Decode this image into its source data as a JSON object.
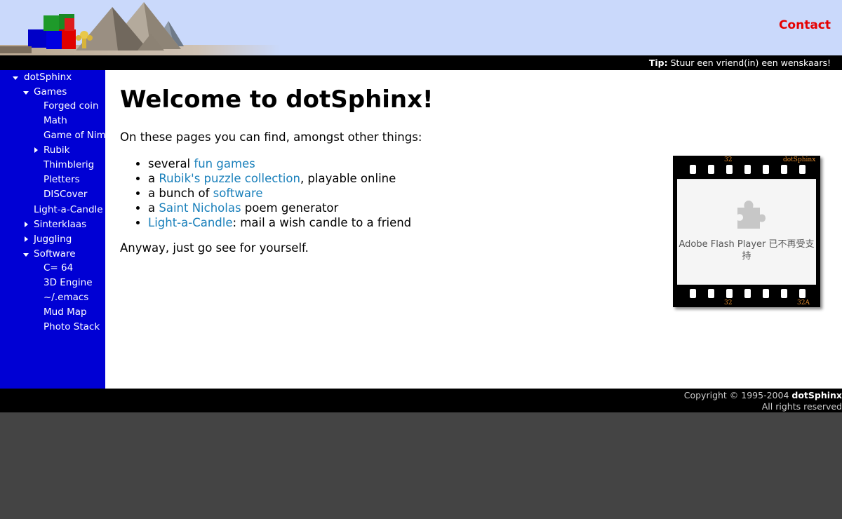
{
  "header": {
    "contact_label": "Contact",
    "tip_label": "Tip:",
    "tip_text": "Stuur een vriend(in) een wenskaars!"
  },
  "sidebar": {
    "items": [
      {
        "label": "dotSphinx",
        "arrow": "down"
      },
      {
        "label": "Games",
        "arrow": "down"
      },
      {
        "label": "Forged coin",
        "arrow": ""
      },
      {
        "label": "Math",
        "arrow": ""
      },
      {
        "label": "Game of Nim",
        "arrow": ""
      },
      {
        "label": "Rubik",
        "arrow": "right"
      },
      {
        "label": "Thimblerig",
        "arrow": ""
      },
      {
        "label": "Pletters",
        "arrow": ""
      },
      {
        "label": "DISCover",
        "arrow": ""
      },
      {
        "label": "Light-a-Candle",
        "arrow": ""
      },
      {
        "label": "Sinterklaas",
        "arrow": "right"
      },
      {
        "label": "Juggling",
        "arrow": "right"
      },
      {
        "label": "Software",
        "arrow": "down"
      },
      {
        "label": "C= 64",
        "arrow": ""
      },
      {
        "label": "3D Engine",
        "arrow": ""
      },
      {
        "label": "~/.emacs",
        "arrow": ""
      },
      {
        "label": "Mud Map",
        "arrow": ""
      },
      {
        "label": "Photo Stack",
        "arrow": ""
      }
    ]
  },
  "main": {
    "title": "Welcome to dotSphinx!",
    "intro": "On these pages you can find, amongst other things:",
    "bullets": [
      {
        "pre": "several ",
        "link": "fun games",
        "post": ""
      },
      {
        "pre": "a ",
        "link": "Rubik's puzzle collection",
        "post": ", playable online"
      },
      {
        "pre": "a bunch of ",
        "link": "software",
        "post": ""
      },
      {
        "pre": "a ",
        "link": "Saint Nicholas",
        "post": " poem generator"
      },
      {
        "pre": "",
        "link": "Light-a-Candle",
        "post": ": mail a wish candle to a friend"
      }
    ],
    "outro": "Anyway, just go see for yourself.",
    "film": {
      "top_left_num": "32",
      "top_right_label": "dotSphinx",
      "bottom_left_num": "32",
      "bottom_right_num": "32A",
      "plugin_message": "Adobe Flash Player 已不再受支持"
    }
  },
  "footer": {
    "copyright_prefix": "Copyright © 1995-2004 ",
    "copyright_brand": "dotSphinx",
    "rights": "All rights reserved"
  },
  "colors": {
    "header_bg": "#cad9fb",
    "sidebar_bg": "#0000d4",
    "contact": "#e60000",
    "link": "#1a80bb",
    "page_bg": "#444444"
  }
}
